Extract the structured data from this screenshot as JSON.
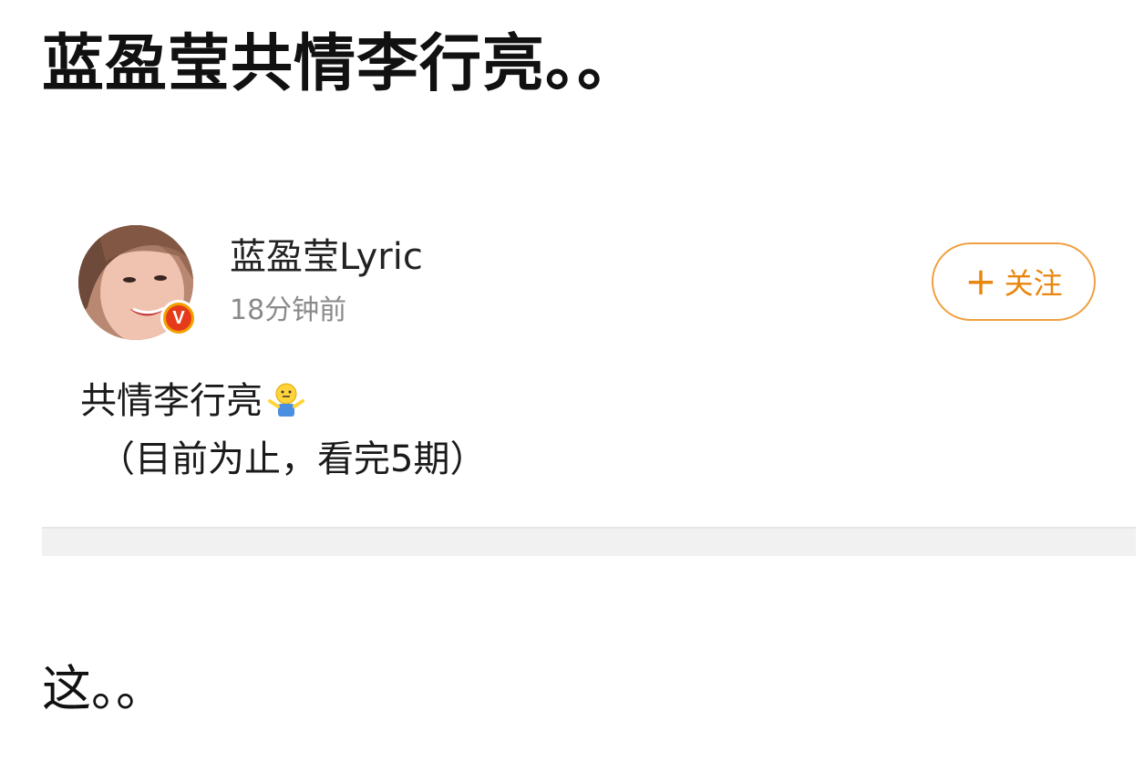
{
  "headline": "蓝盈莹共情李行亮。。",
  "post": {
    "author": "蓝盈莹Lyric",
    "timestamp": "18分钟前",
    "verified_badge": "V",
    "follow_button": {
      "plus": "+",
      "label": "关注"
    },
    "line1": "共情李行亮",
    "line1_emoji": "shrug-emoji-icon",
    "line2": "（目前为止，看完5期）"
  },
  "footer_text": "这。。",
  "colors": {
    "accent_orange": "#e8860e",
    "follow_border": "#f0a040",
    "badge_red": "#e63b1a",
    "badge_gold": "#f2a000",
    "timestamp_gray": "#8a8a8a",
    "divider_gray": "#f1f1f1"
  }
}
